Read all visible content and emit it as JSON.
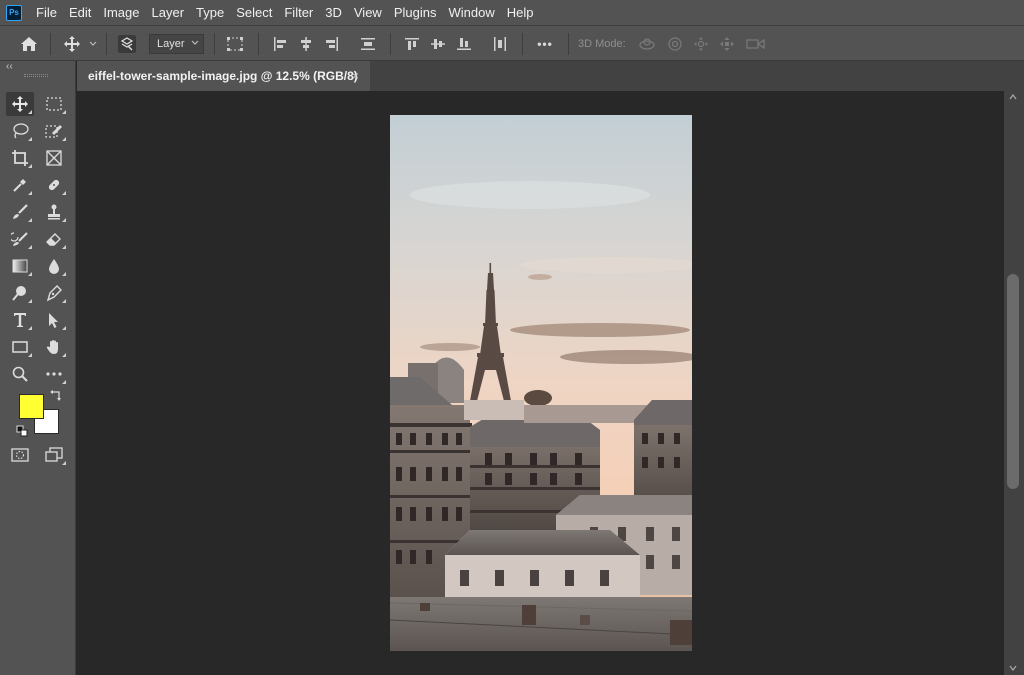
{
  "app": {
    "logo_text": "Ps"
  },
  "menu": [
    "File",
    "Edit",
    "Image",
    "Layer",
    "Type",
    "Select",
    "Filter",
    "3D",
    "View",
    "Plugins",
    "Window",
    "Help"
  ],
  "options_bar": {
    "auto_select_target": "Layer",
    "mode_3d_label": "3D Mode:",
    "more_label": "•••"
  },
  "toolbar": {
    "collapse_label": "‹‹",
    "foreground_color": "#ffff33",
    "background_color": "#ffffff"
  },
  "document": {
    "tab_title": "eiffel-tower-sample-image.jpg @ 12.5% (RGB/8)",
    "close_label": "×"
  }
}
